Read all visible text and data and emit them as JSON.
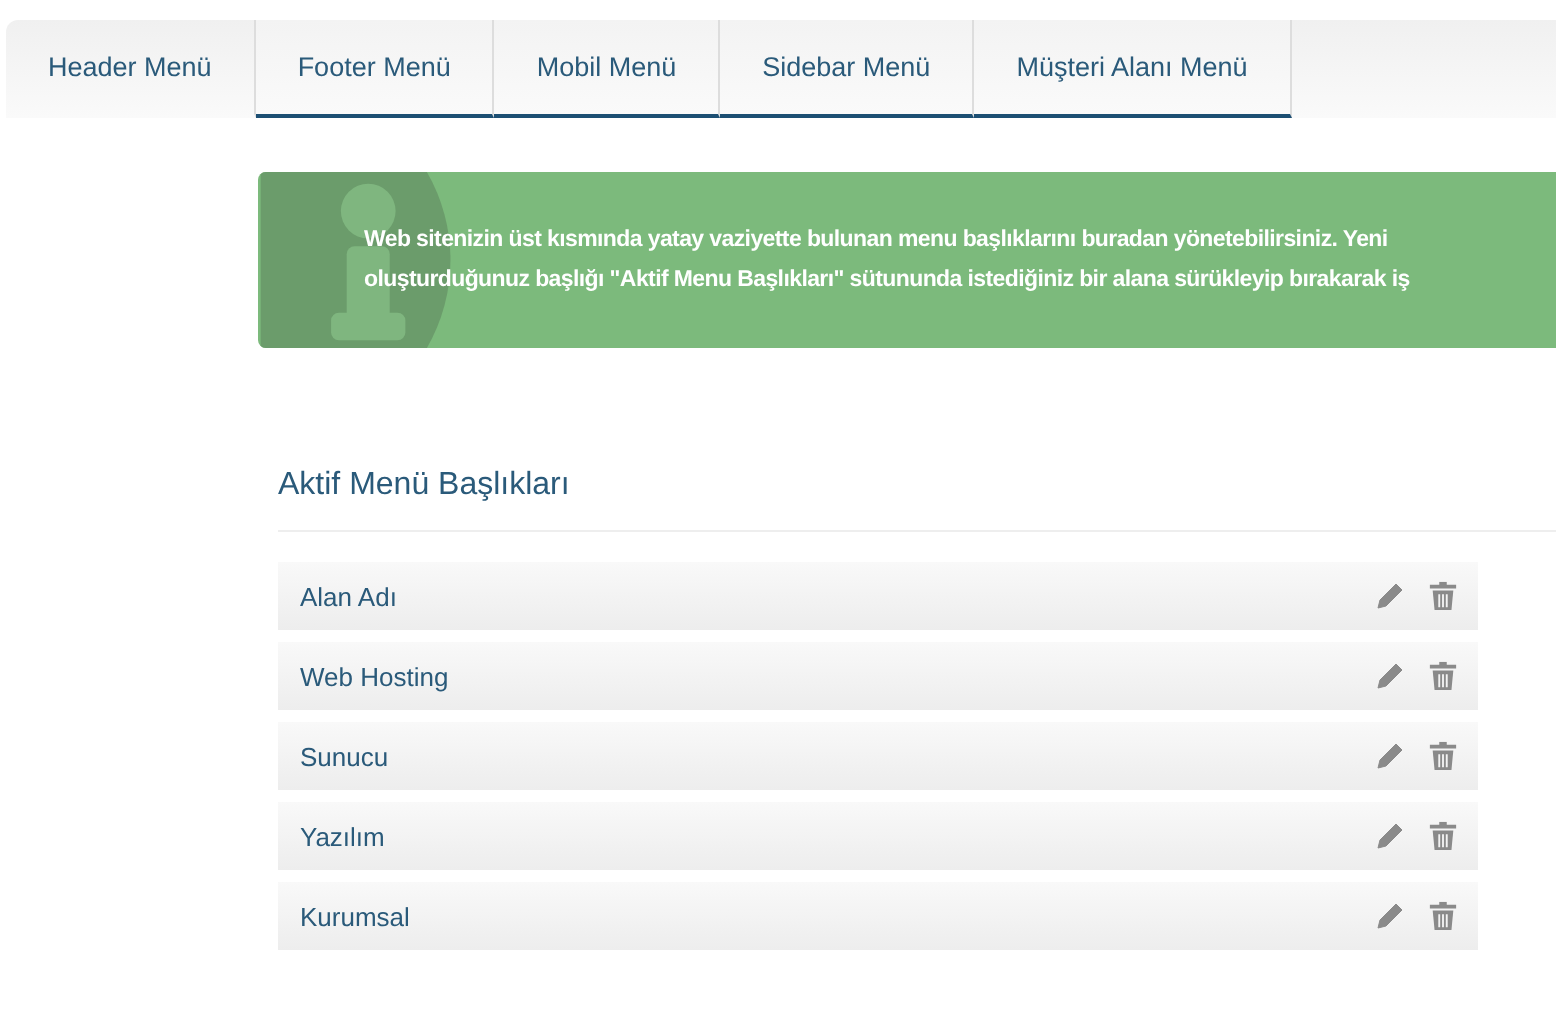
{
  "tabs": [
    {
      "label": "Header Menü",
      "selected": true
    },
    {
      "label": "Footer Menü",
      "selected": false
    },
    {
      "label": "Mobil Menü",
      "selected": false
    },
    {
      "label": "Sidebar Menü",
      "selected": false
    },
    {
      "label": "Müşteri Alanı Menü",
      "selected": false
    }
  ],
  "notice": {
    "lines": [
      "Web sitenizin üst kısmında yatay vaziyette bulunan menu başlıklarını buradan yönetebilirsiniz. Yeni",
      "oluşturduğunuz başlığı \"Aktif Menu Başlıkları\" sütununda istediğiniz bir alana sürükleyip bırakarak iş"
    ]
  },
  "section_title": "Aktif Menü Başlıkları",
  "menu_items": [
    {
      "label": "Alan Adı"
    },
    {
      "label": "Web Hosting"
    },
    {
      "label": "Sunucu"
    },
    {
      "label": "Yazılım"
    },
    {
      "label": "Kurumsal"
    }
  ]
}
